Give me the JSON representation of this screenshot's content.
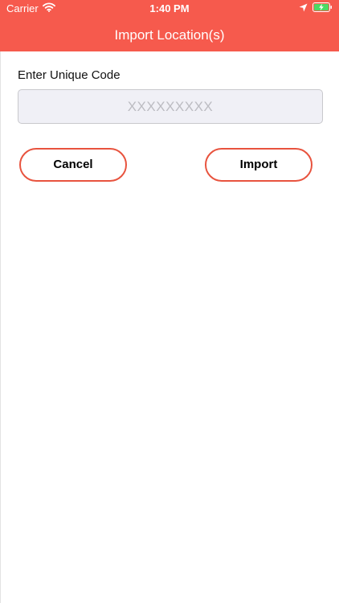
{
  "status_bar": {
    "carrier": "Carrier",
    "time": "1:40 PM",
    "icons": [
      "wifi-icon",
      "location-arrow-icon",
      "battery-charging-icon"
    ]
  },
  "nav": {
    "title": "Import Location(s)"
  },
  "form": {
    "label": "Enter Unique Code",
    "input_value": "",
    "input_placeholder": "XXXXXXXXX"
  },
  "buttons": {
    "cancel_label": "Cancel",
    "import_label": "Import"
  },
  "colors": {
    "header_bg": "#f65a4d",
    "button_border": "#e8533e",
    "input_bg": "#f0f0f6"
  }
}
